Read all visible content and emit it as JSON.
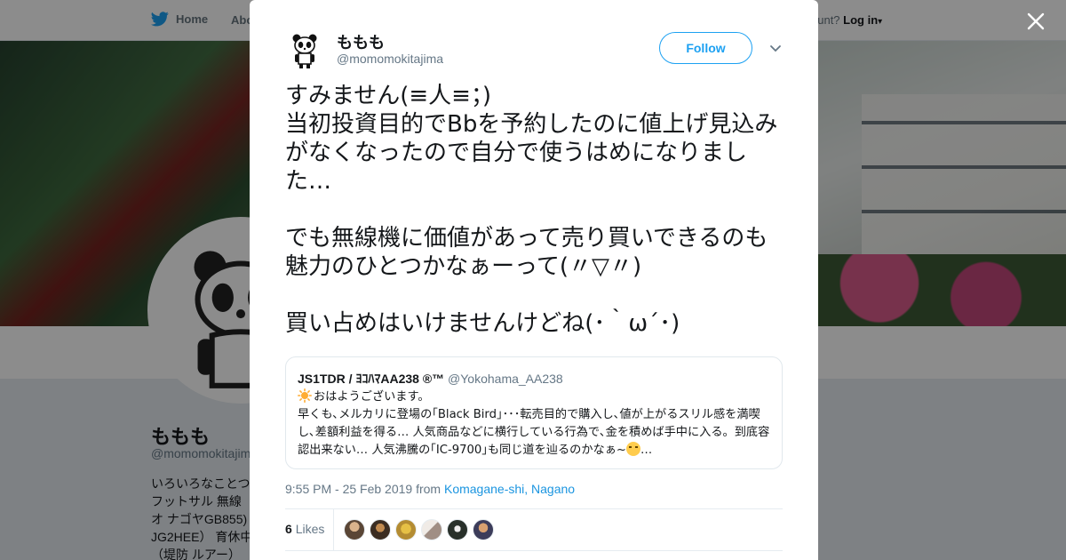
{
  "nav": {
    "home_label": "Home",
    "about_label": "Abo",
    "account_prompt": "ccount?",
    "login_label": "Log in"
  },
  "profile": {
    "name": "ももも",
    "handle": "@momomokitajima",
    "bio": "いろいろなことつ\nフットサル 無線\nオ ナゴヤGB855)\nJG2HEE） 育休中\n（堤防 ルアー）"
  },
  "tweet": {
    "author_name": "ももも",
    "author_handle": "@momomokitajima",
    "follow_label": "Follow",
    "text": "すみません(≡人≡；)\n当初投資目的でBbを予約したのに値上げ見込みがなくなったので自分で使うはめになりました…\n\nでも無線機に価値があって売り買いできるのも魅力のひとつかなぁーって(〃▽〃)\n\n買い占めはいけませんけどね(･｀ω´･)",
    "quote": {
      "name": "JS1TDR / ﾖｺﾊﾏAA238 ®™",
      "handle": "@Yokohama_AA238",
      "line1": "おはようございます。",
      "body": "早くも､メルカリに登場の｢Black Bird｣･･･転売目的で購入し､値が上がるスリル感を満喫し､差額利益を得る… 人気商品などに横行している行為で､金を積めば手中に入る。到底容認出来ない… 人気沸騰の｢IC-9700｣も同じ道を辿るのかなぁ~",
      "ellipsis": "…"
    },
    "timestamp": "9:55 PM - 25 Feb 2019",
    "from_label": "from",
    "location": "Komagane-shi, Nagano",
    "likes_count": "6",
    "likes_label": "Likes"
  },
  "colors": {
    "accent": "#1da1f2",
    "link": "#1b95e0",
    "muted": "#657786",
    "text": "#14171a",
    "backdrop": "rgba(0,0,0,0.45)"
  },
  "icons": [
    "twitter-bird-icon",
    "close-icon",
    "chevron-down-icon",
    "sun-emoji-icon",
    "confounded-face-emoji-icon"
  ],
  "liker_avatars": [
    "#5a4636",
    "#3b2d22",
    "#b48c32",
    "#a08e84",
    "#28302a",
    "#3c3c5a"
  ]
}
